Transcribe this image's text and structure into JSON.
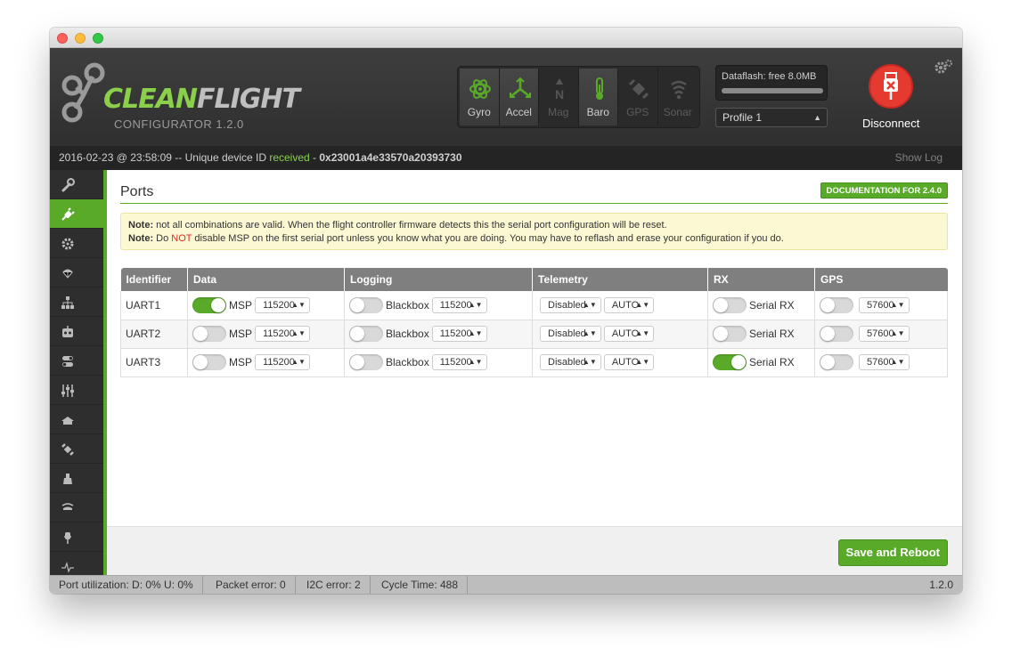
{
  "window": {
    "title": ""
  },
  "header": {
    "logo_text_a": "CLEAN",
    "logo_text_b": "FLIGHT",
    "logo_sub": "CONFIGURATOR 1.2.0",
    "sensors": [
      {
        "label": "Gyro",
        "active": true,
        "icon": "gyro-icon"
      },
      {
        "label": "Accel",
        "active": true,
        "icon": "accel-icon"
      },
      {
        "label": "Mag",
        "active": false,
        "icon": "mag-icon"
      },
      {
        "label": "Baro",
        "active": true,
        "icon": "baro-icon"
      },
      {
        "label": "GPS",
        "active": false,
        "icon": "gps-icon"
      },
      {
        "label": "Sonar",
        "active": false,
        "icon": "sonar-icon"
      }
    ],
    "dataflash": {
      "text": "Dataflash: free 8.0MB",
      "free_fraction": 1.0
    },
    "profile": {
      "selected": "Profile 1"
    },
    "connect": {
      "label": "Disconnect"
    }
  },
  "status_strip": {
    "prefix": "2016-02-23 @ 23:58:09 -- Unique device ID ",
    "received": "received",
    "dash": " - ",
    "device_id": "0x23001a4e33570a20393730",
    "show_log": "Show Log"
  },
  "sidebar": {
    "items": [
      {
        "name": "setup",
        "icon": "wrench-icon"
      },
      {
        "name": "ports",
        "icon": "plug-icon",
        "active": true
      },
      {
        "name": "configuration",
        "icon": "gear-icon"
      },
      {
        "name": "failsafe",
        "icon": "parachute-icon"
      },
      {
        "name": "pid-tuning",
        "icon": "hierarchy-icon"
      },
      {
        "name": "receiver",
        "icon": "robot-icon"
      },
      {
        "name": "modes",
        "icon": "switches-icon"
      },
      {
        "name": "adjustments",
        "icon": "sliders-icon"
      },
      {
        "name": "servos",
        "icon": "servo-icon"
      },
      {
        "name": "gps",
        "icon": "satellite-icon"
      },
      {
        "name": "motors",
        "icon": "motor-icon"
      },
      {
        "name": "led-strip",
        "icon": "led-icon"
      },
      {
        "name": "sensors",
        "icon": "pin-icon"
      },
      {
        "name": "logging",
        "icon": "pulse-icon"
      }
    ]
  },
  "main": {
    "title": "Ports",
    "doc_button": "DOCUMENTATION FOR 2.4.0",
    "note": {
      "l1_bold": "Note:",
      "l1_text": " not all combinations are valid. When the flight controller firmware detects this the serial port configuration will be reset.",
      "l2_bold": "Note:",
      "l2_pre": " Do ",
      "l2_red": "NOT",
      "l2_post": " disable MSP on the first serial port unless you know what you are doing. You may have to reflash and erase your configuration if you do."
    },
    "table": {
      "headers": [
        "Identifier",
        "Data",
        "Logging",
        "Telemetry",
        "RX",
        "GPS"
      ],
      "rows": [
        {
          "id": "UART1",
          "msp_on": true,
          "msp": "MSP",
          "msp_baud": "115200",
          "bb_on": false,
          "bb": "Blackbox",
          "bb_baud": "115200",
          "tel": "Disabled",
          "tel_baud": "AUTO",
          "rx_on": false,
          "rx": "Serial RX",
          "gps_on": false,
          "gps_baud": "57600"
        },
        {
          "id": "UART2",
          "msp_on": false,
          "msp": "MSP",
          "msp_baud": "115200",
          "bb_on": false,
          "bb": "Blackbox",
          "bb_baud": "115200",
          "tel": "Disabled",
          "tel_baud": "AUTO",
          "rx_on": false,
          "rx": "Serial RX",
          "gps_on": false,
          "gps_baud": "57600"
        },
        {
          "id": "UART3",
          "msp_on": false,
          "msp": "MSP",
          "msp_baud": "115200",
          "bb_on": false,
          "bb": "Blackbox",
          "bb_baud": "115200",
          "tel": "Disabled",
          "tel_baud": "AUTO",
          "rx_on": true,
          "rx": "Serial RX",
          "gps_on": false,
          "gps_baud": "57600"
        }
      ]
    },
    "save_button": "Save and Reboot"
  },
  "statusbar": {
    "port_util": "Port utilization: D: 0% U: 0%",
    "packet_error": "Packet error: 0",
    "i2c_error": "I2C error: 2",
    "cycle_time": "Cycle Time: 488",
    "version": "1.2.0"
  },
  "colors": {
    "accent": "#59aa29",
    "disconnect": "#e53a2f",
    "header_bg": "#333333"
  }
}
